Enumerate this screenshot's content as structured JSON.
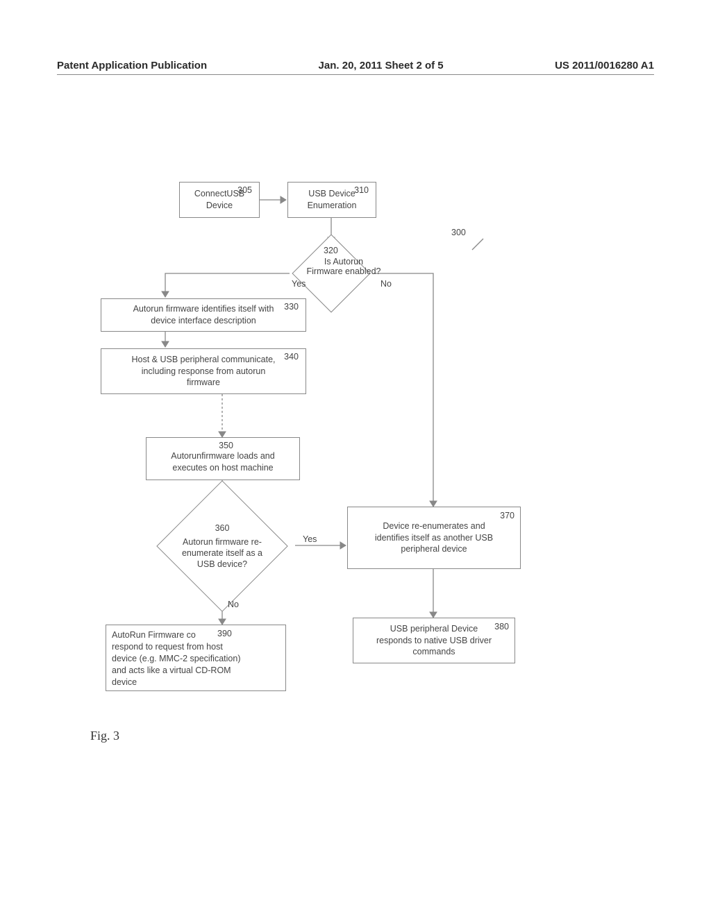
{
  "header": {
    "left": "Patent Application Publication",
    "center": "Jan. 20, 2011  Sheet 2 of 5",
    "right": "US 2011/0016280 A1"
  },
  "boxes": {
    "b305": {
      "num": "305",
      "text": "ConnectUSB\nDevice"
    },
    "b310": {
      "num": "310",
      "text": "USB Device\nEnumeration"
    },
    "b330": {
      "num": "330",
      "text": "Autorun firmware identifies itself with\ndevice interface description"
    },
    "b340": {
      "num": "340",
      "text": "Host & USB peripheral communicate,\nincluding response from autorun\nfirmware"
    },
    "b350": {
      "num": "350",
      "text": "Autorunfirmware loads and\nexecutes on host machine"
    },
    "b370": {
      "num": "370",
      "text": "Device re-enumerates and\nidentifies itself as another USB\nperipheral device"
    },
    "b380": {
      "num": "380",
      "text": "USB peripheral Device\nresponds to native USB driver\ncommands"
    },
    "b390": {
      "num": "390",
      "text": "AutoRun Firmware co\nrespond to request from host\ndevice (e.g. MMC-2 specification)\nand acts like a virtual CD-ROM\ndevice"
    }
  },
  "diamonds": {
    "d320": {
      "num": "320",
      "text": "Is Autorun\nFirmware enabled?"
    },
    "d360": {
      "num": "360",
      "text": "Autorun firmware re-\nenumerate itself as a\nUSB device?"
    }
  },
  "labels": {
    "yes320": "Yes",
    "no320": "No",
    "yes360": "Yes",
    "no360": "No",
    "ref300": "300"
  },
  "figure": "Fig. 3"
}
